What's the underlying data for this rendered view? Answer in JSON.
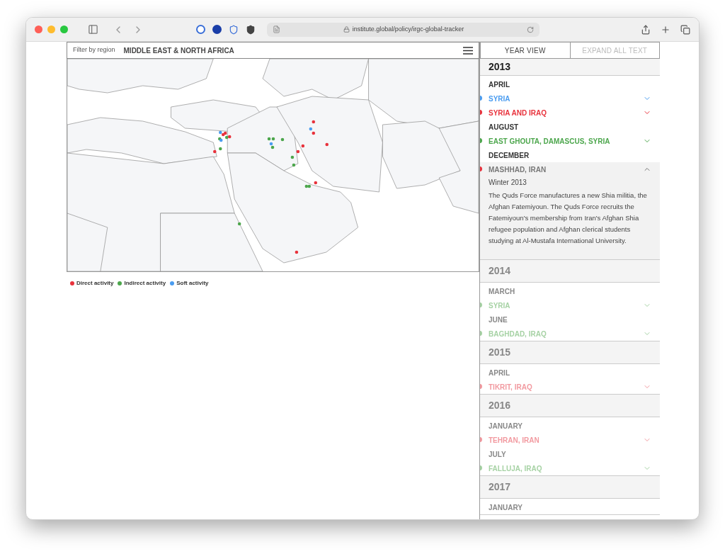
{
  "browser": {
    "url": "institute.global/policy/irgc-global-tracker"
  },
  "filter": {
    "label": "Filter by region",
    "value": "MIDDLE EAST & NORTH AFRICA"
  },
  "legend": [
    {
      "label": "Direct activity",
      "color": "#e8323c"
    },
    {
      "label": "Indirect activity",
      "color": "#4ca64c"
    },
    {
      "label": "Soft activity",
      "color": "#4a9cf0"
    }
  ],
  "tabs": [
    {
      "label": "YEAR VIEW",
      "selected": true
    },
    {
      "label": "EXPAND ALL TEXT",
      "selected": false
    }
  ],
  "years": [
    {
      "year": "2013",
      "dimmed": false,
      "months": [
        {
          "month": "APRIL",
          "entries": [
            {
              "place": "SYRIA",
              "kind": "soft",
              "expanded": false
            },
            {
              "place": "SYRIA AND IRAQ",
              "kind": "direct",
              "expanded": false
            }
          ]
        },
        {
          "month": "AUGUST",
          "entries": [
            {
              "place": "EAST GHOUTA, DAMASCUS, SYRIA",
              "kind": "indirect",
              "expanded": false
            }
          ]
        },
        {
          "month": "DECEMBER",
          "entries": [
            {
              "place": "MASHHAD, IRAN",
              "kind": "direct",
              "expanded": true,
              "date": "Winter 2013",
              "text": "The Quds Force manufactures a new Shia militia, the Afghan Fatemiyoun. The Quds Force recruits the Fatemiyoun's membership from Iran's Afghan Shia refugee population and Afghan clerical students studying at Al-Mustafa International University."
            }
          ]
        }
      ]
    },
    {
      "year": "2014",
      "dimmed": true,
      "months": [
        {
          "month": "MARCH",
          "entries": [
            {
              "place": "SYRIA",
              "kind": "indirect",
              "expanded": false
            }
          ]
        },
        {
          "month": "JUNE",
          "entries": [
            {
              "place": "BAGHDAD, IRAQ",
              "kind": "indirect",
              "expanded": false
            }
          ]
        }
      ]
    },
    {
      "year": "2015",
      "dimmed": true,
      "months": [
        {
          "month": "APRIL",
          "entries": [
            {
              "place": "TIKRIT, IRAQ",
              "kind": "direct",
              "expanded": false
            }
          ]
        }
      ]
    },
    {
      "year": "2016",
      "dimmed": true,
      "months": [
        {
          "month": "JANUARY",
          "entries": [
            {
              "place": "TEHRAN, IRAN",
              "kind": "direct",
              "expanded": false
            }
          ]
        },
        {
          "month": "JULY",
          "entries": [
            {
              "place": "FALLUJA, IRAQ",
              "kind": "indirect",
              "expanded": false
            }
          ]
        }
      ]
    },
    {
      "year": "2017",
      "dimmed": true,
      "months": [
        {
          "month": "JANUARY"
        }
      ]
    }
  ]
}
